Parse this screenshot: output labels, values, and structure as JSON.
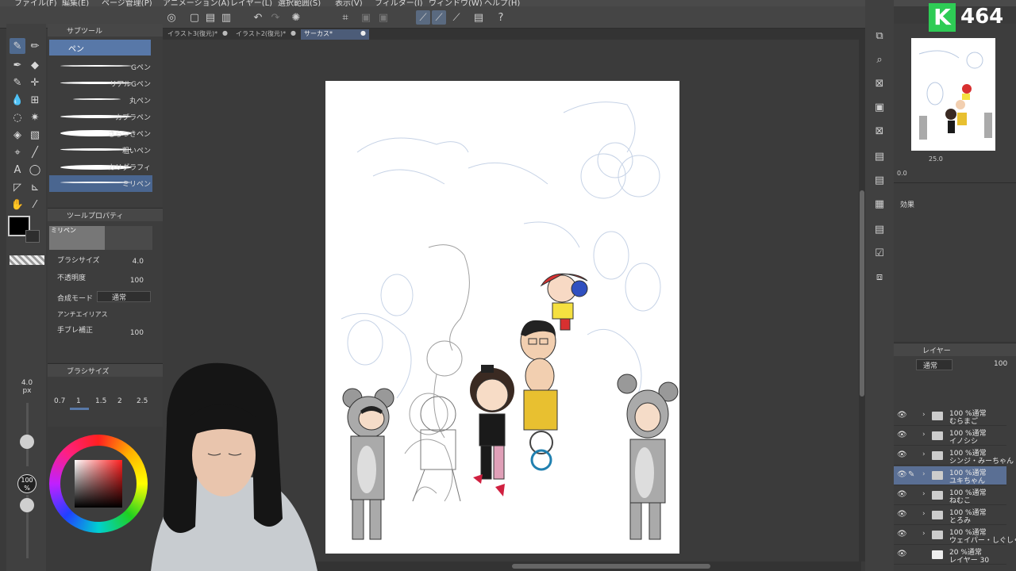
{
  "menubar": {
    "items": [
      "ファイル(F)",
      "編集(E)",
      "ページ管理(P)",
      "アニメーション(A)",
      "レイヤー(L)",
      "選択範囲(S)",
      "表示(V)",
      "フィルター(I)",
      "ウィンドウ(W)",
      "ヘルプ(H)"
    ]
  },
  "tabs": [
    {
      "label": "イラスト3(復元)*"
    },
    {
      "label": "イラスト2(復元)*"
    },
    {
      "label": "サーカス*"
    }
  ],
  "subtool": {
    "header": "サブツール",
    "selected": "ペン",
    "brushes": [
      "Gペン",
      "リアルGペン",
      "丸ペン",
      "カブラペン",
      "さらつきペン",
      "粗いペン",
      "カリグラフィ",
      "ミリペン"
    ]
  },
  "toolprop": {
    "header": "ツールプロパティ",
    "name": "ミリペン",
    "brush_size_label": "ブラシサイズ",
    "brush_size_value": "4.0",
    "opacity_label": "不透明度",
    "opacity_value": "100",
    "blend_label": "合成モード",
    "blend_value": "通常",
    "antialias_label": "アンチエイリアス",
    "stabilize_label": "手ブレ補正",
    "stabilize_value": "100"
  },
  "brushsize": {
    "header": "ブラシサイズ",
    "values": [
      "0.7",
      "1",
      "1.5",
      "2",
      "2.5"
    ],
    "selected_index": 1
  },
  "left_slider": {
    "size_label": "4.0",
    "size_unit": "px",
    "opacity_label": "100",
    "opacity_unit": "%"
  },
  "navigator": {
    "zoom": "25.0",
    "rotation": "0.0"
  },
  "effects": {
    "title": "効果"
  },
  "layers": {
    "header": "レイヤー",
    "blend": "通常",
    "opacity": "100",
    "rows": [
      {
        "line1": "100 %通常",
        "line2": "むらまご",
        "selected": false,
        "type": "folder"
      },
      {
        "line1": "100 %通常",
        "line2": "イノシシ",
        "selected": false,
        "type": "folder"
      },
      {
        "line1": "100 %通常",
        "line2": "シンジ・みーちゃん",
        "selected": false,
        "type": "folder"
      },
      {
        "line1": "100 %通常",
        "line2": "ユキちゃん",
        "selected": true,
        "type": "folder"
      },
      {
        "line1": "100 %通常",
        "line2": "ねむこ",
        "selected": false,
        "type": "folder"
      },
      {
        "line1": "100 %通常",
        "line2": "とろみ",
        "selected": false,
        "type": "folder"
      },
      {
        "line1": "100 %通常",
        "line2": "ウェイパー・しぐしぐ",
        "selected": false,
        "type": "folder"
      },
      {
        "line1": "20 %通常",
        "line2": "レイヤー 30",
        "selected": false,
        "type": "raster"
      }
    ]
  },
  "logo": {
    "letter": "K",
    "number": "464"
  },
  "colors": {
    "accent": "#5878a8",
    "main_color": "#000000"
  }
}
